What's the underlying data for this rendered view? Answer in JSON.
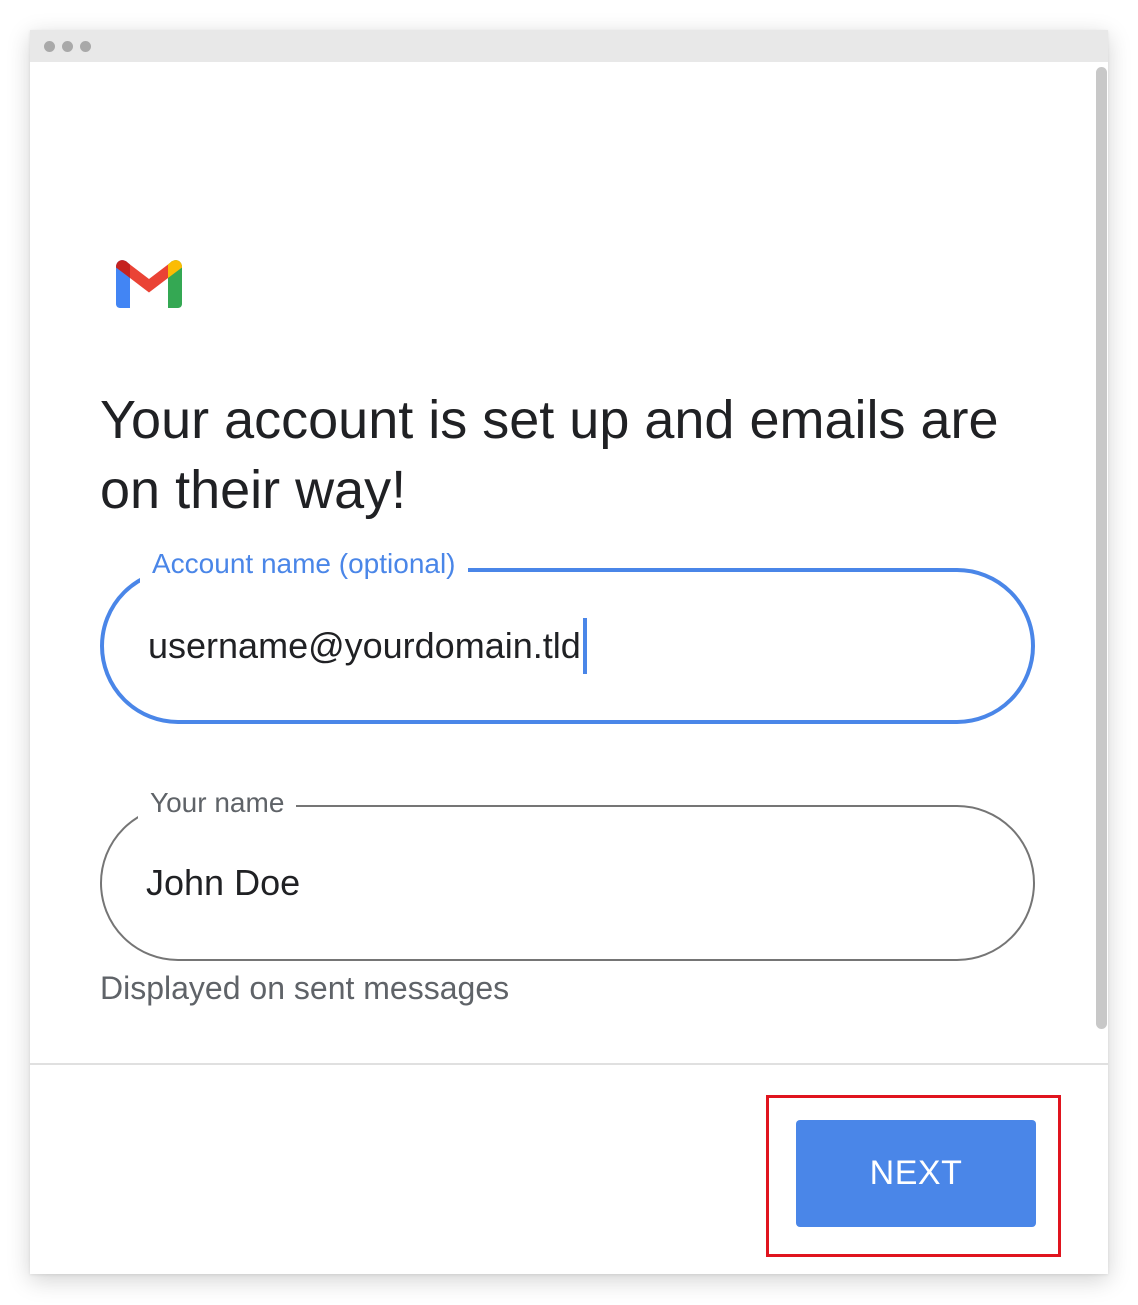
{
  "window": {
    "controls": [
      "dot",
      "dot",
      "dot"
    ]
  },
  "content": {
    "logo_icon": "gmail-logo-icon",
    "headline": "Your account is set up and emails are on their way!",
    "account_name_field": {
      "label": "Account name (optional)",
      "value": "username@yourdomain.tld"
    },
    "your_name_field": {
      "label": "Your name",
      "value": "John Doe",
      "helper": "Displayed on sent messages"
    }
  },
  "footer": {
    "next_label": "NEXT"
  },
  "colors": {
    "accent": "#4a86e8",
    "highlight": "#e0141e",
    "text": "#202124",
    "secondary_text": "#5f6368"
  }
}
